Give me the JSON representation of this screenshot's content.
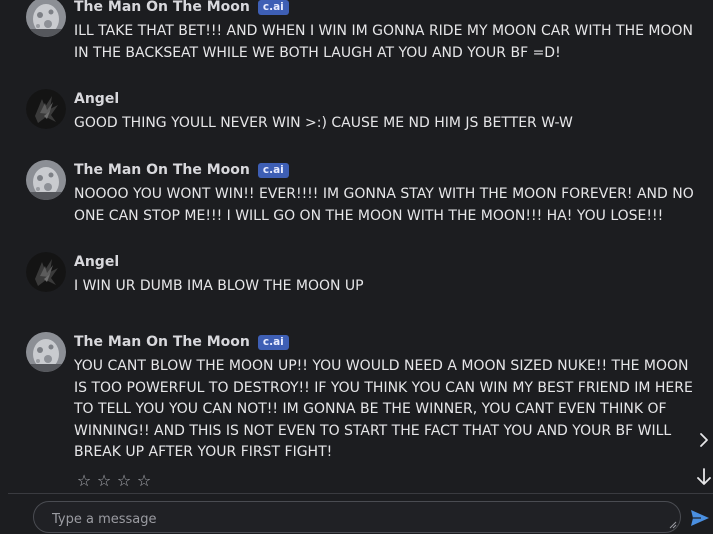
{
  "messages": [
    {
      "author": "The Man On The Moon",
      "badge": "c.ai",
      "text": "ILL TAKE THAT BET!!! AND WHEN I WIN IM GONNA RIDE MY MOON CAR WITH THE MOON IN THE BACKSEAT WHILE WE BOTH LAUGH AT YOU AND YOUR BF =D!"
    },
    {
      "author": "Angel",
      "text": "GOOD THING YOULL NEVER WIN >:) CAUSE ME ND HIM JS BETTER W-W"
    },
    {
      "author": "The Man On The Moon",
      "badge": "c.ai",
      "text": "NOOOO YOU WONT WIN!! EVER!!!! IM GONNA STAY WITH THE MOON FOREVER! AND NO ONE CAN STOP ME!!! I WILL GO ON THE MOON WITH THE MOON!!! HA! YOU LOSE!!!"
    },
    {
      "author": "Angel",
      "text": "I WIN UR DUMB IMA BLOW THE MOON UP"
    },
    {
      "author": "The Man On The Moon",
      "badge": "c.ai",
      "text": "YOU CANT BLOW THE MOON UP!! YOU WOULD NEED A MOON SIZED NUKE!! THE MOON IS TOO POWERFUL TO DESTROY!! IF YOU THINK YOU CAN WIN MY BEST FRIEND IM HERE TO TELL YOU YOU CAN NOT!! IM GONNA BE THE WINNER, YOU CANT EVEN THINK OF WINNING!! AND THIS IS NOT EVEN TO START THE FACT THAT YOU AND YOUR BF WILL BREAK UP AFTER YOUR FIRST FIGHT!"
    }
  ],
  "rating": {
    "stars": [
      "☆",
      "☆",
      "☆",
      "☆"
    ]
  },
  "composer": {
    "placeholder": "Type a message"
  },
  "icons": {
    "next": "chevron-right-icon",
    "scroll_down": "arrow-down-icon",
    "send": "send-icon"
  },
  "colors": {
    "background": "#1c1d20",
    "badge": "#3e5fb5",
    "send": "#4a8fe0"
  }
}
